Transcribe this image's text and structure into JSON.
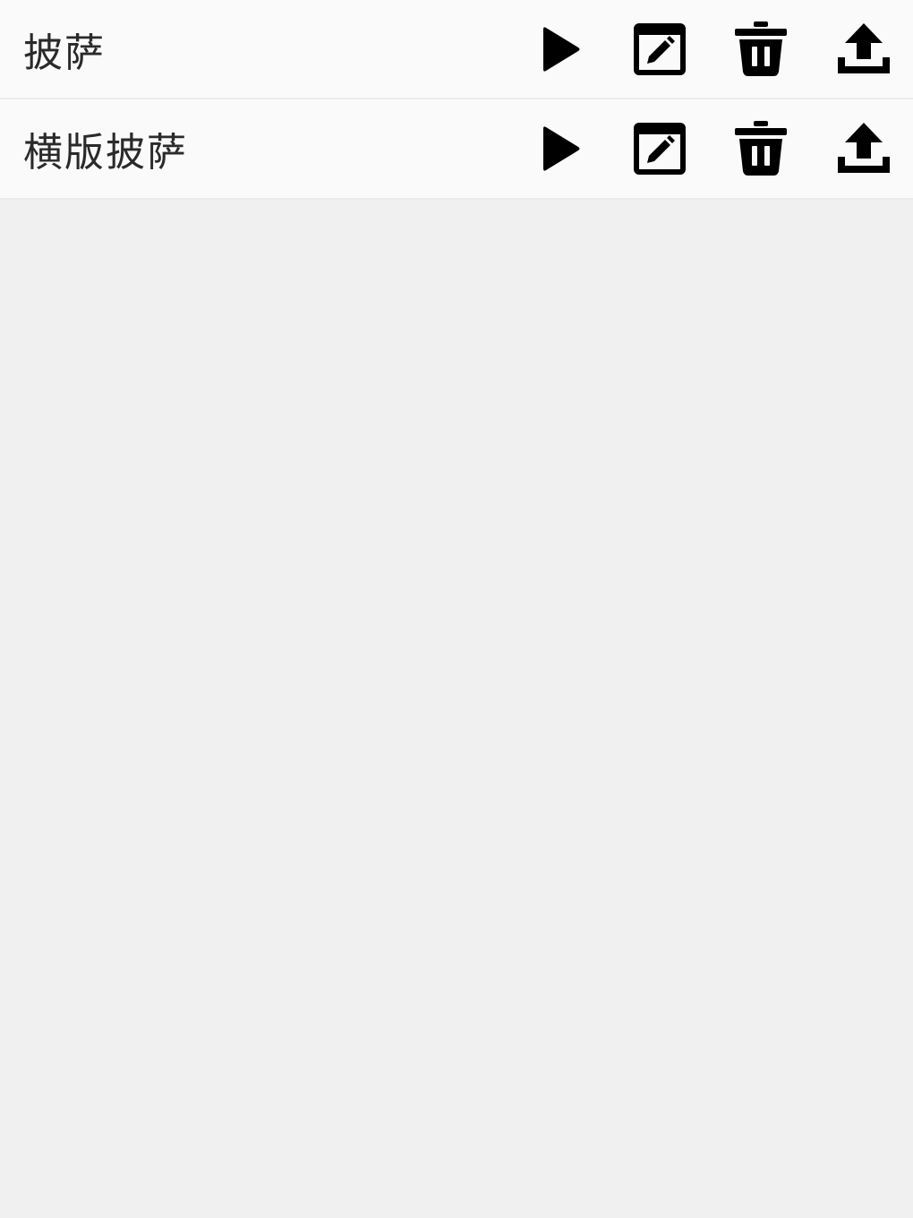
{
  "list": {
    "items": [
      {
        "label": "披萨"
      },
      {
        "label": "横版披萨"
      }
    ]
  },
  "icons": {
    "play": "play-icon",
    "edit": "edit-icon",
    "delete": "trash-icon",
    "upload": "upload-icon"
  },
  "colors": {
    "background": "#f0f0f0",
    "row_background": "#fafafa",
    "icon": "#000000",
    "text": "#2a2a2a"
  }
}
